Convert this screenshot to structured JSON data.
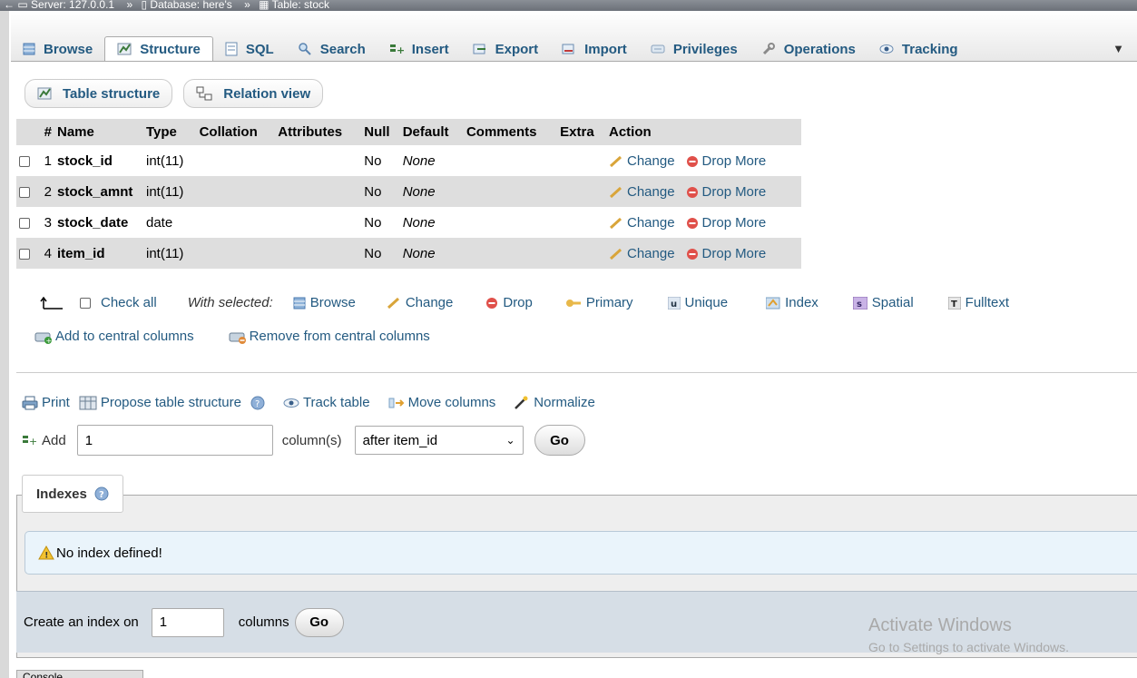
{
  "breadcrumb": {
    "server": "Server: 127.0.0.1",
    "database": "Database: here's",
    "table": "Table: stock",
    "separator": "»"
  },
  "tabs": [
    {
      "label": "Browse",
      "icon": "browse-icon"
    },
    {
      "label": "Structure",
      "icon": "structure-icon",
      "active": true
    },
    {
      "label": "SQL",
      "icon": "sql-icon"
    },
    {
      "label": "Search",
      "icon": "search-icon"
    },
    {
      "label": "Insert",
      "icon": "insert-icon"
    },
    {
      "label": "Export",
      "icon": "export-icon"
    },
    {
      "label": "Import",
      "icon": "import-icon"
    },
    {
      "label": "Privileges",
      "icon": "privileges-icon"
    },
    {
      "label": "Operations",
      "icon": "wrench-icon"
    },
    {
      "label": "Tracking",
      "icon": "eye-icon"
    }
  ],
  "subtabs": {
    "table_structure": "Table structure",
    "relation_view": "Relation view"
  },
  "columns_table": {
    "headers": [
      "#",
      "Name",
      "Type",
      "Collation",
      "Attributes",
      "Null",
      "Default",
      "Comments",
      "Extra",
      "Action"
    ],
    "rows": [
      {
        "num": "1",
        "name": "stock_id",
        "type": "int(11)",
        "null": "No",
        "default": "None"
      },
      {
        "num": "2",
        "name": "stock_amnt",
        "type": "int(11)",
        "null": "No",
        "default": "None"
      },
      {
        "num": "3",
        "name": "stock_date",
        "type": "date",
        "null": "No",
        "default": "None"
      },
      {
        "num": "4",
        "name": "item_id",
        "type": "int(11)",
        "null": "No",
        "default": "None"
      }
    ],
    "actions": {
      "change": "Change",
      "drop": "Drop",
      "more": "More"
    }
  },
  "bulk": {
    "check_all": "Check all",
    "with_selected": "With selected:",
    "browse": "Browse",
    "change": "Change",
    "drop": "Drop",
    "primary": "Primary",
    "unique": "Unique",
    "index": "Index",
    "spatial": "Spatial",
    "fulltext": "Fulltext"
  },
  "central": {
    "add": "Add to central columns",
    "remove": "Remove from central columns"
  },
  "printbar": {
    "print": "Print",
    "propose": "Propose table structure",
    "track": "Track table",
    "move": "Move columns",
    "normalize": "Normalize"
  },
  "add_columns": {
    "label": "Add",
    "value": "1",
    "unit": "column(s)",
    "position": "after item_id",
    "go": "Go"
  },
  "indexes": {
    "title": "Indexes",
    "notice": "No index defined!",
    "create_label": "Create an index on",
    "create_value": "1",
    "create_unit": "columns",
    "go": "Go"
  },
  "watermark": {
    "line1": "Activate Windows",
    "line2": "Go to Settings to activate Windows."
  },
  "console": {
    "label": "Console"
  },
  "colors": {
    "link": "#235a81",
    "header_bg": "#dddddd",
    "row_alt": "#dedede",
    "notice_bg": "#eaf4fb"
  }
}
